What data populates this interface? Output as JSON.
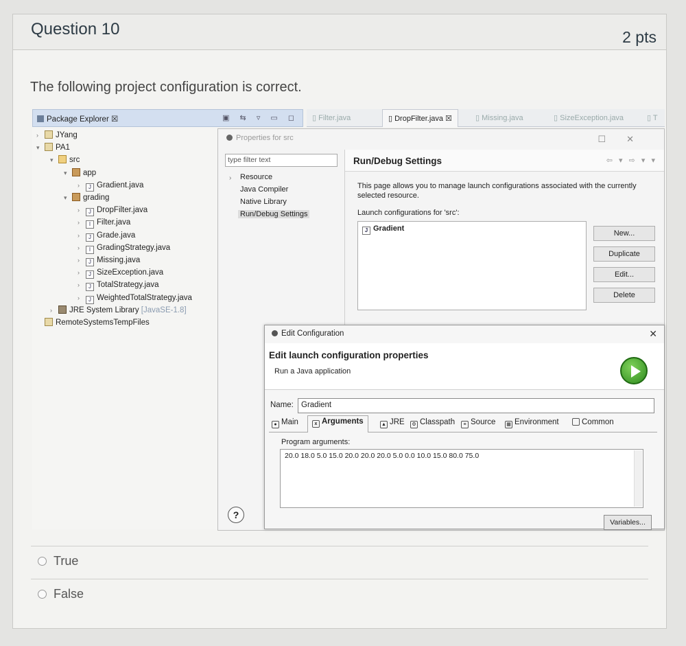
{
  "question": {
    "title": "Question 10",
    "points": "2 pts",
    "text": "The following project configuration is correct."
  },
  "package_explorer": {
    "title": "Package Explorer",
    "tree": [
      {
        "label": "JYang",
        "indent": 0,
        "twisty": ">",
        "icon": "project"
      },
      {
        "label": "PA1",
        "indent": 0,
        "twisty": "v",
        "icon": "project"
      },
      {
        "label": "src",
        "indent": 1,
        "twisty": "v",
        "icon": "folder"
      },
      {
        "label": "app",
        "indent": 2,
        "twisty": "v",
        "icon": "package"
      },
      {
        "label": "Gradient.java",
        "indent": 3,
        "twisty": ">",
        "icon": "java"
      },
      {
        "label": "grading",
        "indent": 2,
        "twisty": "v",
        "icon": "package"
      },
      {
        "label": "DropFilter.java",
        "indent": 3,
        "twisty": ">",
        "icon": "java"
      },
      {
        "label": "Filter.java",
        "indent": 3,
        "twisty": ">",
        "icon": "interface"
      },
      {
        "label": "Grade.java",
        "indent": 3,
        "twisty": ">",
        "icon": "java"
      },
      {
        "label": "GradingStrategy.java",
        "indent": 3,
        "twisty": ">",
        "icon": "interface"
      },
      {
        "label": "Missing.java",
        "indent": 3,
        "twisty": ">",
        "icon": "java"
      },
      {
        "label": "SizeException.java",
        "indent": 3,
        "twisty": ">",
        "icon": "java"
      },
      {
        "label": "TotalStrategy.java",
        "indent": 3,
        "twisty": ">",
        "icon": "java"
      },
      {
        "label": "WeightedTotalStrategy.java",
        "indent": 3,
        "twisty": ">",
        "icon": "java"
      },
      {
        "label": "JRE System Library",
        "suffix": "[JavaSE-1.8]",
        "indent": 1,
        "twisty": ">",
        "icon": "library"
      },
      {
        "label": "RemoteSystemsTempFiles",
        "indent": 0,
        "twisty": "",
        "icon": "project"
      }
    ]
  },
  "editor_tabs": [
    {
      "label": "Filter.java",
      "active": false
    },
    {
      "label": "DropFilter.java",
      "active": true
    },
    {
      "label": "Missing.java",
      "active": false
    },
    {
      "label": "SizeException.java",
      "active": false
    },
    {
      "label": "T",
      "active": false
    }
  ],
  "properties_dialog": {
    "title": "Properties for src",
    "filter_placeholder": "type filter text",
    "nav": [
      "Resource",
      "Java Compiler",
      "Native Library",
      "Run/Debug Settings"
    ],
    "selected_nav": "Run/Debug Settings",
    "page_title": "Run/Debug Settings",
    "description": "This page allows you to manage launch configurations associated with the currently selected resource.",
    "launch_label": "Launch configurations for 'src':",
    "configurations": [
      "Gradient"
    ],
    "buttons": [
      "New...",
      "Duplicate",
      "Edit...",
      "Delete"
    ],
    "help": "?"
  },
  "edit_dialog": {
    "title": "Edit Configuration",
    "heading": "Edit launch configuration properties",
    "subheading": "Run a Java application",
    "name_label": "Name:",
    "name_value": "Gradient",
    "tabs": [
      "Main",
      "Arguments",
      "JRE",
      "Classpath",
      "Source",
      "Environment",
      "Common"
    ],
    "active_tab": "Arguments",
    "program_args_label": "Program arguments:",
    "program_args": "20.0 18.0 5.0 15.0 20.0 20.0 20.0 5.0 0.0 10.0 15.0 80.0 75.0",
    "variables_button": "Variables..."
  },
  "answers": [
    {
      "label": "True"
    },
    {
      "label": "False"
    }
  ]
}
